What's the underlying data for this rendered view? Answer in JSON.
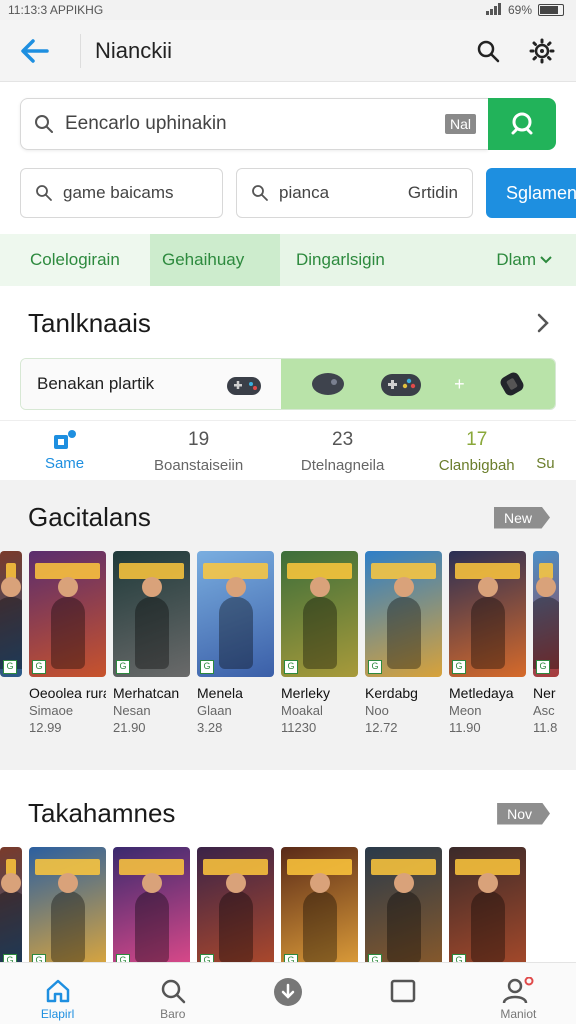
{
  "status": {
    "time": "11:13:3 APPIKHG",
    "battery": "69%"
  },
  "app_bar": {
    "title": "Nianckii"
  },
  "search": {
    "value": "Eencarlo uphinakin",
    "badge": "Nal"
  },
  "chips": [
    {
      "label": "game baicams"
    },
    {
      "label": "pianca",
      "extra": "Grtidin"
    },
    {
      "label": "Sglamen"
    }
  ],
  "categories": [
    "Colelogirain",
    "Gehaihuay",
    "Dingarlsigin",
    "Dlam"
  ],
  "tank_section": {
    "title": "Tanlknaais",
    "banner_text": "Benakan plartik"
  },
  "stats": [
    {
      "num": "",
      "label": "Same"
    },
    {
      "num": "19",
      "label": "Boanstaiseiin"
    },
    {
      "num": "23",
      "label": "Dtelnagneila"
    },
    {
      "num": "17",
      "label": "Clanbigbah"
    },
    {
      "num": "",
      "label": "Su"
    }
  ],
  "games_section": {
    "title": "Gacitalans",
    "tag": "New",
    "cards": [
      {
        "title": "Oeoolea rurat",
        "sub": "Simaoe",
        "price": "12.99",
        "palette": [
          "#5a2d6e",
          "#c8532c"
        ]
      },
      {
        "title": "Merhatcan",
        "sub": "Nesan",
        "price": "21.90",
        "palette": [
          "#1f3a3a",
          "#6a6a6a"
        ]
      },
      {
        "title": "Menela",
        "sub": "Glaan",
        "price": "3.28",
        "palette": [
          "#7aaee0",
          "#3b5fa8"
        ]
      },
      {
        "title": "Merleky",
        "sub": "Moakal",
        "price": "11230",
        "palette": [
          "#3c6e3a",
          "#a89a3a"
        ]
      },
      {
        "title": "Kerdabg",
        "sub": "Noo",
        "price": "12.72",
        "palette": [
          "#2e7fc8",
          "#d8a23a"
        ]
      },
      {
        "title": "Metledaya",
        "sub": "Meon",
        "price": "11.90",
        "palette": [
          "#2a2f55",
          "#d66a2a"
        ]
      },
      {
        "title": "Ner",
        "sub": "Asc",
        "price": "11.8",
        "palette": [
          "#4a8fc8",
          "#a83a3a"
        ]
      }
    ]
  },
  "second_section": {
    "title": "Takahamnes",
    "tag": "Nov",
    "cards": [
      {
        "palette": [
          "#2b5fa0",
          "#e0a83a"
        ]
      },
      {
        "palette": [
          "#3a2a6e",
          "#e04a8a"
        ]
      },
      {
        "palette": [
          "#3a2348",
          "#b04a2a"
        ]
      },
      {
        "palette": [
          "#5a2a18",
          "#e0a03a"
        ]
      },
      {
        "palette": [
          "#2a3a4a",
          "#8a5a2a"
        ]
      },
      {
        "palette": [
          "#3a2a2a",
          "#a84a2a"
        ]
      }
    ]
  },
  "bottom_nav": [
    {
      "label": "Elapirl",
      "icon": "home-icon"
    },
    {
      "label": "Baro",
      "icon": "search-icon"
    },
    {
      "label": "",
      "icon": "download-icon"
    },
    {
      "label": "",
      "icon": "square-icon"
    },
    {
      "label": "Maniot",
      "icon": "profile-icon"
    }
  ]
}
